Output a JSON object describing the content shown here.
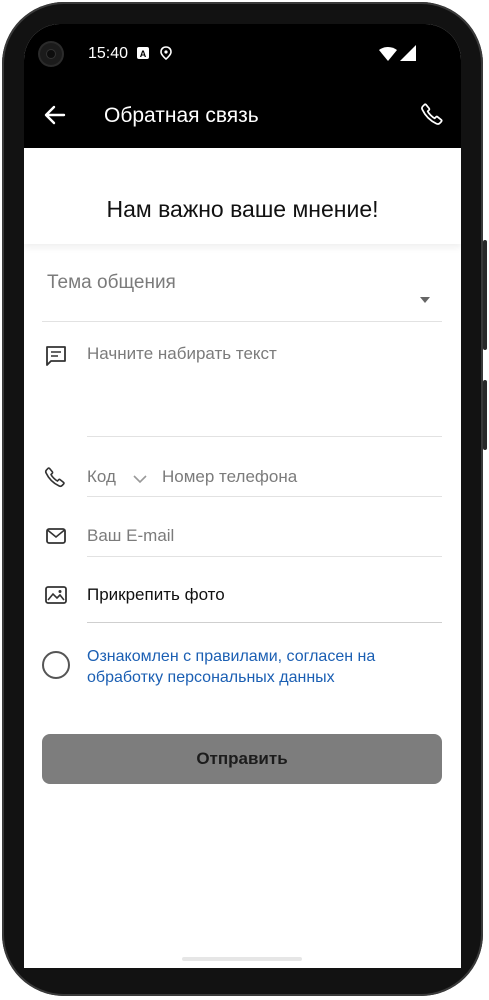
{
  "status_bar": {
    "time": "15:40",
    "icons": [
      "camera-icon",
      "text-icon",
      "location-icon",
      "wifi-icon",
      "signal-icon"
    ]
  },
  "app_bar": {
    "title": "Обратная связь",
    "icons": [
      "back-arrow-icon",
      "phone-icon"
    ]
  },
  "header": {
    "title": "Нам важно ваше мнение!"
  },
  "form": {
    "topic_placeholder": "Тема общения",
    "message_placeholder": "Начните набирать текст",
    "phone_code_placeholder": "Код",
    "phone_number_placeholder": "Номер телефона",
    "email_placeholder": "Ваш E-mail",
    "attach_label": "Прикрепить фото",
    "consent_label": "Ознакомлен с правилами, согласен на обработку персональных данных",
    "submit_label": "Отправить"
  },
  "colors": {
    "appbar": "#000000",
    "link": "#1b5fb3",
    "submit_disabled": "#7d7d7d"
  }
}
